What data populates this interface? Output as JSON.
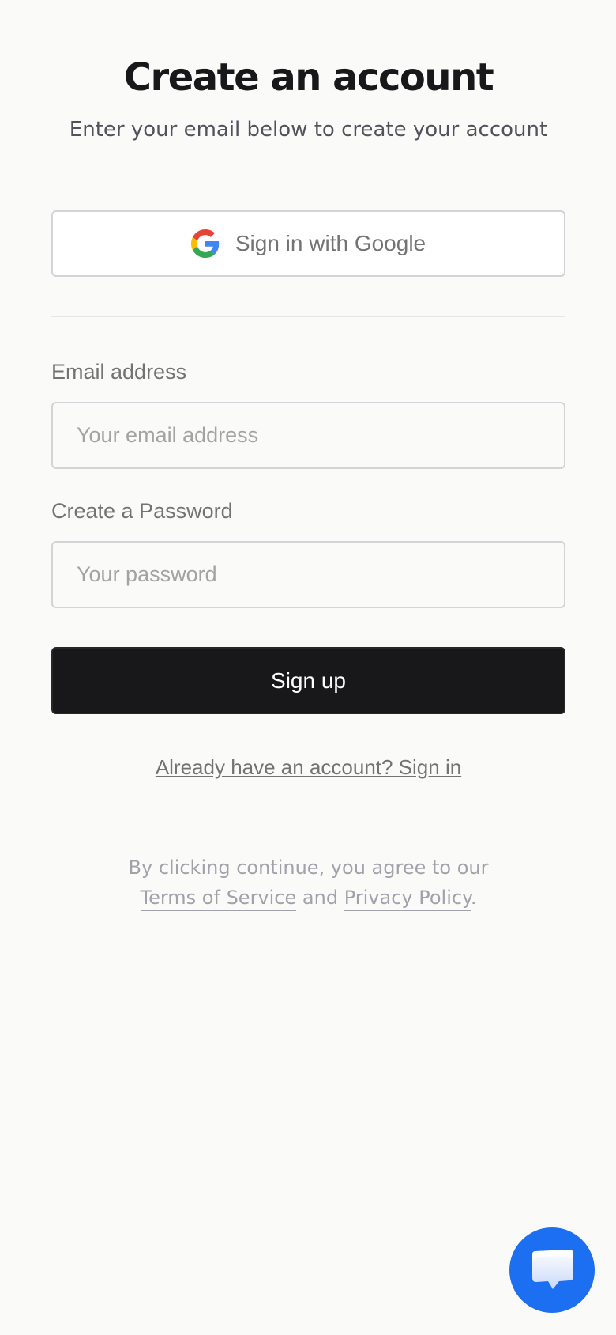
{
  "header": {
    "title": "Create an account",
    "subtitle": "Enter your email below to create your account"
  },
  "oauth": {
    "google_label": "Sign in with Google",
    "icon": "google-icon"
  },
  "form": {
    "email_label": "Email address",
    "email_placeholder": "Your email address",
    "email_value": "",
    "password_label": "Create a Password",
    "password_placeholder": "Your password",
    "password_value": "",
    "submit_label": "Sign up"
  },
  "links": {
    "signin": "Already have an account? Sign in"
  },
  "legal": {
    "prefix": "By clicking continue, you agree to our",
    "terms": "Terms of Service",
    "and": "and",
    "privacy": "Privacy Policy",
    "suffix": "."
  },
  "chat": {
    "icon": "chat-bubble-icon"
  },
  "colors": {
    "background": "#fafaf9",
    "primary_button": "#18181b",
    "chat_launcher": "#1d6ff2"
  }
}
